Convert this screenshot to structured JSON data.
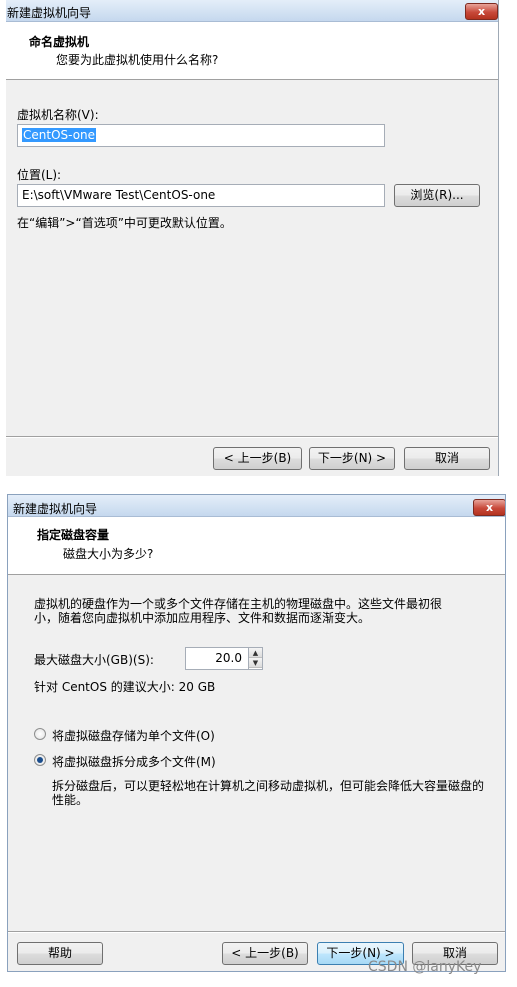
{
  "dialog1": {
    "title": "新建虚拟机向导",
    "close_label": "x",
    "header_title": "命名虚拟机",
    "header_subtitle": "您要为此虚拟机使用什么名称?",
    "vm_name_label": "虚拟机名称(V):",
    "vm_name_value": "CentOS-one",
    "location_label": "位置(L):",
    "location_value": "E:\\soft\\VMware Test\\CentOS-one",
    "browse_label": "浏览(R)...",
    "hint": "在“编辑”>“首选项”中可更改默认位置。",
    "back_label": "< 上一步(B)",
    "next_label": "下一步(N) >",
    "cancel_label": "取消"
  },
  "dialog2": {
    "title": "新建虚拟机向导",
    "close_label": "x",
    "header_title": "指定磁盘容量",
    "header_subtitle": "磁盘大小为多少?",
    "desc_line1": "虚拟机的硬盘作为一个或多个文件存储在主机的物理磁盘中。这些文件最初很",
    "desc_line2": "小，随着您向虚拟机中添加应用程序、文件和数据而逐渐变大。",
    "max_size_label": "最大磁盘大小(GB)(S):",
    "max_size_value": "20.0",
    "recommend": "针对 CentOS 的建议大小: 20 GB",
    "radio_single": "将虚拟磁盘存储为单个文件(O)",
    "radio_split": "将虚拟磁盘拆分成多个文件(M)",
    "split_desc_line1": "拆分磁盘后，可以更轻松地在计算机之间移动虚拟机，但可能会降低大容量磁盘的",
    "split_desc_line2": "性能。",
    "help_label": "帮助",
    "back_label": "< 上一步(B)",
    "next_label": "下一步(N) >",
    "cancel_label": "取消"
  },
  "watermark": "CSDN @lanyKey"
}
